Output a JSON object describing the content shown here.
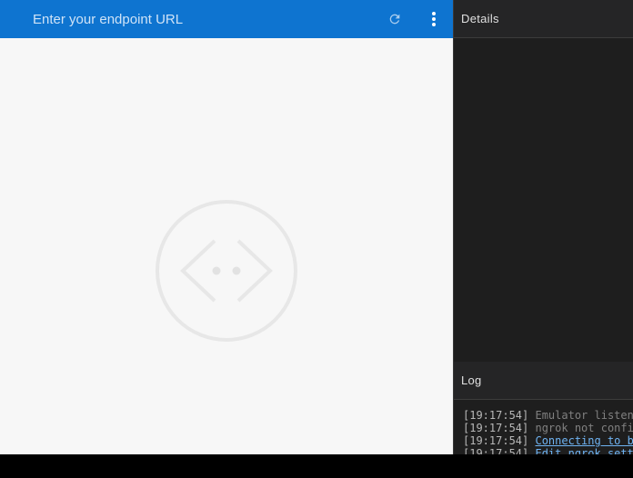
{
  "address_bar": {
    "placeholder": "Enter your endpoint URL",
    "value": ""
  },
  "toolbar": {
    "refresh_icon": "refresh-icon",
    "more_icon": "more-vertical-icon"
  },
  "details_panel": {
    "title": "Details"
  },
  "log_panel": {
    "title": "Log",
    "entries": [
      {
        "timestamp": "[19:17:54]",
        "message": "Emulator listen"
      },
      {
        "timestamp": "[19:17:54]",
        "message": "ngrok not confi"
      },
      {
        "timestamp": "[19:17:54]",
        "message": "Connecting to b"
      },
      {
        "timestamp": "[19:17:54]",
        "message": "Edit ngrok sett"
      }
    ]
  },
  "colors": {
    "topbar": "#0e74d0",
    "panel_bg": "#1e1e1e",
    "link": "#6fb3f2"
  }
}
